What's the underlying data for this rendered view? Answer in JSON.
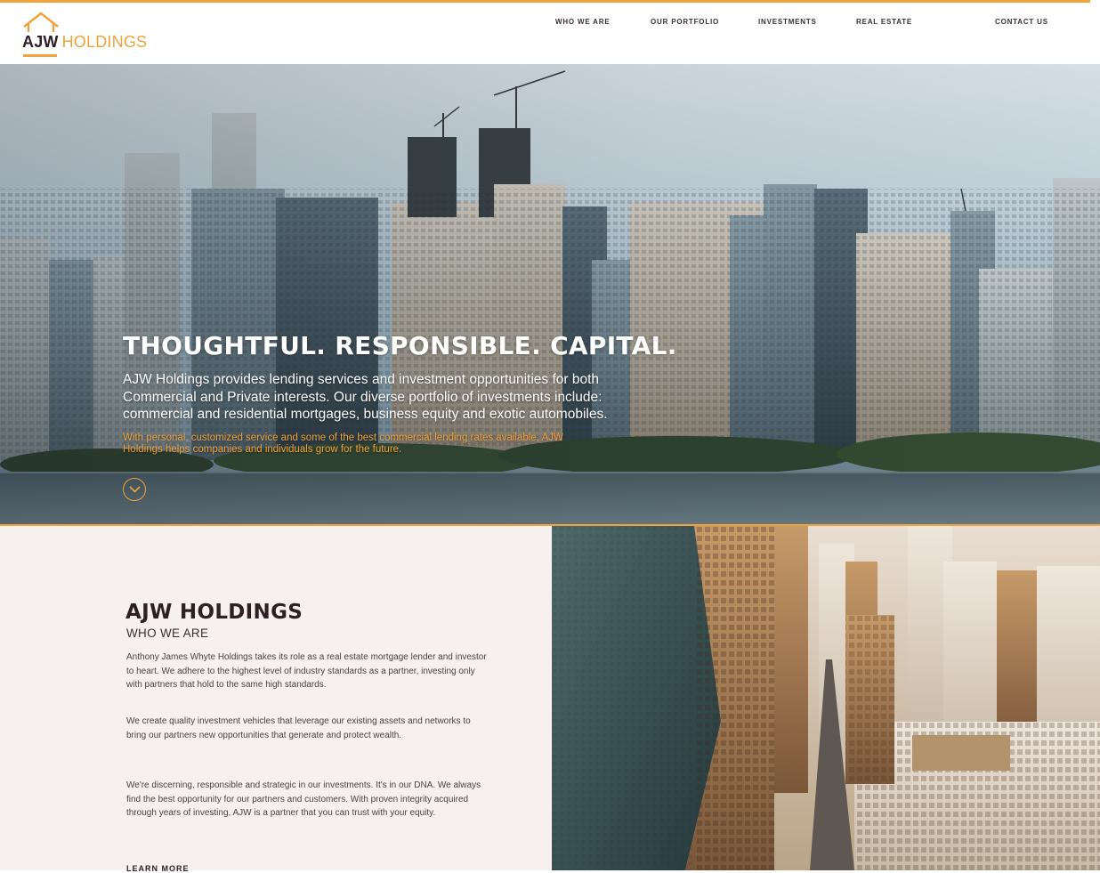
{
  "brand": {
    "logo_part1": "AJW",
    "logo_part2": "HOLDINGS",
    "accent_color": "#f0a23c",
    "dark_color": "#2d1f24",
    "logo_icon": "house-roof-icon"
  },
  "nav": {
    "items": [
      {
        "label": "WHO WE ARE"
      },
      {
        "label": "OUR PORTFOLIO"
      },
      {
        "label": "INVESTMENTS"
      },
      {
        "label": "REAL ESTATE"
      },
      {
        "label": "CONTACT US"
      }
    ]
  },
  "hero": {
    "title": "THOUGHTFUL. RESPONSIBLE. CAPITAL.",
    "lead": "AJW Holdings provides lending services and investment opportunities for both Commercial and Private interests. Our diverse portfolio of investments include: commercial and residential mortgages, business equity and exotic automobiles.",
    "sub": "With personal, customized service and some of the best commercial lending rates available, AJW Holdings helps companies and individuals grow for the future.",
    "scroll_icon": "chevron-down-circle-icon"
  },
  "about": {
    "title": "AJW HOLDINGS",
    "subtitle": "WHO WE ARE",
    "paragraphs": [
      "Anthony James Whyte Holdings takes its role as a real estate mortgage lender and investor to heart. We adhere to the highest level of industry standards as a partner, investing only with partners that hold to the same high standards.",
      "We create quality investment vehicles that leverage our existing assets and networks to bring our partners new opportunities that generate and protect wealth.",
      "We're discerning, responsible and strategic in our investments. It's in our DNA. We always find the best opportunity for our partners and customers. With proven integrity acquired through years of investing, AJW is a partner that you can trust with your equity."
    ],
    "learn_more": "LEARN MORE"
  }
}
